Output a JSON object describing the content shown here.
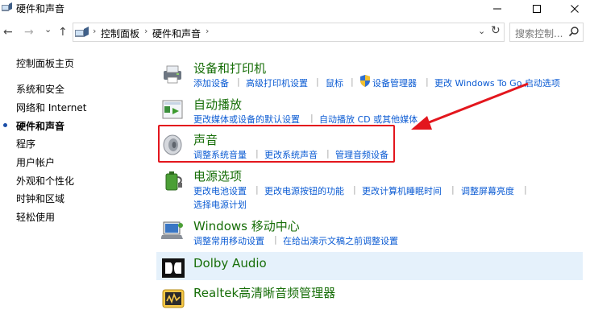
{
  "window": {
    "title": "硬件和声音"
  },
  "nav": {
    "back": "←",
    "forward": "→",
    "recent": "⌄",
    "up": "↑",
    "breadcrumb": [
      "控制面板",
      "硬件和声音"
    ],
    "refresh": "↻",
    "search_placeholder": "搜索控制..."
  },
  "sidebar": {
    "items": [
      "控制面板主页",
      "系统和安全",
      "网络和 Internet",
      "硬件和声音",
      "程序",
      "用户帐户",
      "外观和个性化",
      "时钟和区域",
      "轻松使用"
    ],
    "active_index": 3
  },
  "categories": {
    "devices": {
      "title": "设备和打印机",
      "links": [
        "添加设备",
        "高级打印机设置",
        "鼠标",
        "设备管理器",
        "更改 Windows To Go 启动选项"
      ]
    },
    "autoplay": {
      "title": "自动播放",
      "links": [
        "更改媒体或设备的默认设置",
        "自动播放 CD 或其他媒体"
      ]
    },
    "sound": {
      "title": "声音",
      "links": [
        "调整系统音量",
        "更改系统声音",
        "管理音频设备"
      ]
    },
    "power": {
      "title": "电源选项",
      "links": [
        "更改电池设置",
        "更改电源按钮的功能",
        "更改计算机睡眠时间",
        "调整屏幕亮度",
        "选择电源计划"
      ]
    },
    "mobility": {
      "title": "Windows 移动中心",
      "links": [
        "调整常用移动设置",
        "在给出演示文稿之前调整设置"
      ]
    },
    "dolby": {
      "title": "Dolby Audio"
    },
    "realtek": {
      "title": "Realtek高清晰音频管理器"
    }
  },
  "colors": {
    "category_title": "#176e08",
    "link": "#0b5bd3",
    "highlight_box": "#e3161d",
    "arrow": "#e3161d",
    "hover_band": "#e5f1fb"
  }
}
